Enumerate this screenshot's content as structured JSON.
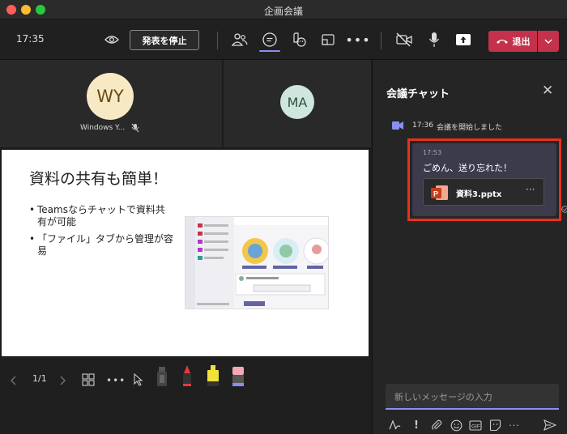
{
  "window": {
    "title": "企画会議"
  },
  "toolbar": {
    "clock": "17:35",
    "stop_presenting_label": "発表を停止",
    "leave_label": "退出",
    "icons": [
      "eye-icon",
      "people-icon",
      "chat-icon",
      "reactions-icon",
      "share-tray-icon",
      "more-icon",
      "camera-off-icon",
      "mic-icon",
      "share-screen-icon",
      "phone-icon",
      "chevron-down-icon"
    ],
    "accent_color": "#c4314b"
  },
  "participants": [
    {
      "initials": "WY",
      "name": "Windows Y...",
      "muted": true
    },
    {
      "initials": "MA"
    }
  ],
  "slide": {
    "title": "資料の共有も簡単！",
    "bullets": [
      "Teamsならチャットで資料共有が可能",
      "「ファイル」タブから管理が容易"
    ]
  },
  "presenter_controls": {
    "page": "1/1"
  },
  "chat": {
    "title": "会議チャット",
    "system": {
      "time": "17:36",
      "text": "会議を開始しました"
    },
    "message": {
      "time": "17:53",
      "text": "ごめん、送り忘れた！",
      "file": "資料3.pptx",
      "file_more": "···"
    },
    "input_placeholder": "新しいメッセージの入力",
    "highlight_color": "#e8301c"
  }
}
